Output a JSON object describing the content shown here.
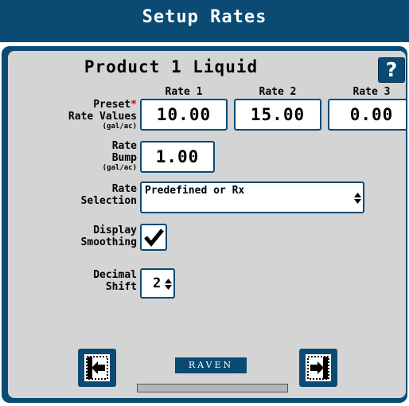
{
  "header": {
    "title": "Setup Rates"
  },
  "product": {
    "title": "Product 1 Liquid",
    "help_label": "?"
  },
  "preset": {
    "label_line1": "Preset",
    "required_mark": "*",
    "label_line2": "Rate Values",
    "unit": "(gal/ac)",
    "columns": [
      {
        "header": "Rate 1",
        "value": "10.00"
      },
      {
        "header": "Rate 2",
        "value": "15.00"
      },
      {
        "header": "Rate 3",
        "value": "0.00"
      }
    ]
  },
  "rate_bump": {
    "label_line1": "Rate",
    "label_line2": "Bump",
    "unit": "(gal/ac)",
    "value": "1.00"
  },
  "rate_selection": {
    "label_line1": "Rate",
    "label_line2": "Selection",
    "value": "Predefined or Rx"
  },
  "display_smoothing": {
    "label_line1": "Display",
    "label_line2": "Smoothing",
    "checked": true
  },
  "decimal_shift": {
    "label_line1": "Decimal",
    "label_line2": "Shift",
    "value": "2"
  },
  "footer": {
    "brand": "RAVEN",
    "progress_fraction": 0
  },
  "colors": {
    "header": "#0a4a73",
    "panel": "#d4d4d4"
  },
  "icons": {
    "back": "back-arrow-icon",
    "next": "next-arrow-icon"
  }
}
